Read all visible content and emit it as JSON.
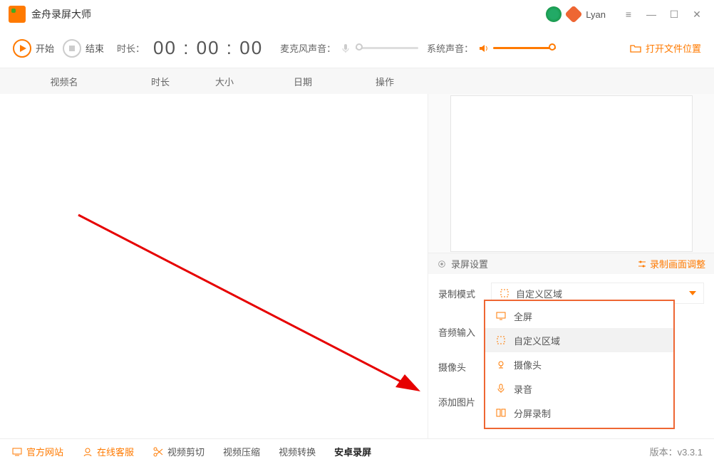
{
  "app": {
    "title": "金舟录屏大师",
    "user": "Lyan"
  },
  "toolbar": {
    "start": "开始",
    "stop": "结束",
    "duration_label": "时长：",
    "timer": "00 : 00 : 00",
    "mic_label": "麦克风声音：",
    "sys_label": "系统声音：",
    "open_folder": "打开文件位置"
  },
  "columns": {
    "name": "视频名",
    "duration": "时长",
    "size": "大小",
    "date": "日期",
    "ops": "操作"
  },
  "settings": {
    "header": "录屏设置",
    "adjust": "录制画面调整",
    "mode_label": "录制模式",
    "mode_value": "自定义区域",
    "audio_label": "音频输入",
    "camera_label": "摄像头",
    "addimg_label": "添加图片"
  },
  "dropdown": {
    "o1": "全屏",
    "o2": "自定义区域",
    "o3": "摄像头",
    "o4": "录音",
    "o5": "分屏录制"
  },
  "footer": {
    "site": "官方网站",
    "service": "在线客服",
    "cut": "视频剪切",
    "compress": "视频压缩",
    "convert": "视频转换",
    "android": "安卓录屏",
    "version": "版本：v3.3.1"
  }
}
